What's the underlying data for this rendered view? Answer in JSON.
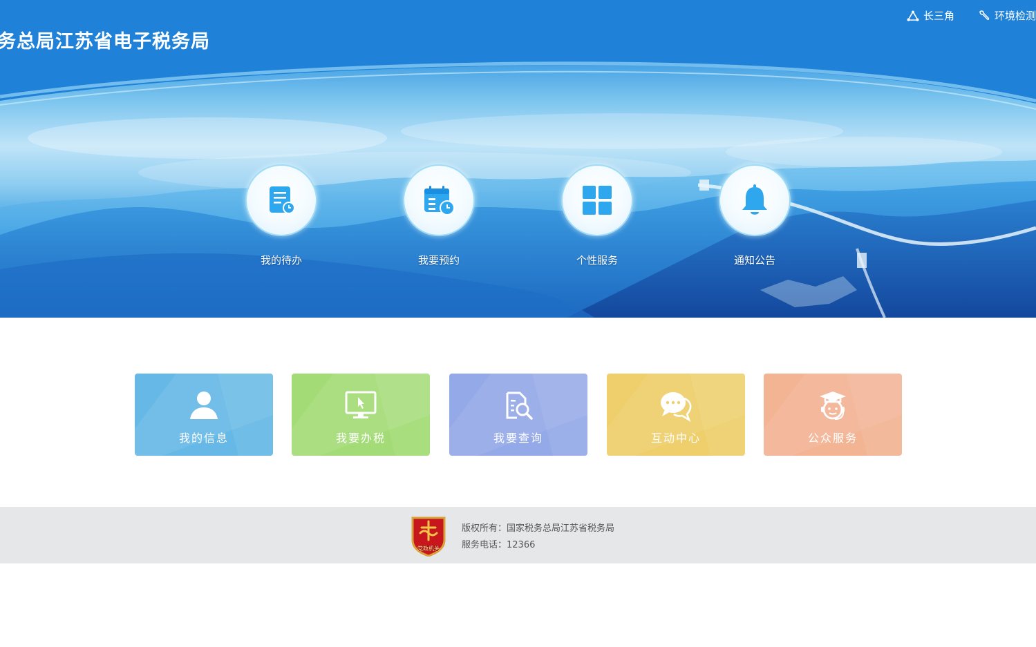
{
  "header": {
    "site_title": "务总局江苏省电子税务局",
    "links": [
      {
        "label": "长三角",
        "icon": "triangle-nodes-icon"
      },
      {
        "label": "环境检测",
        "icon": "wrench-icon"
      }
    ]
  },
  "quick_entries": [
    {
      "label": "我的待办",
      "icon": "todo-list-icon"
    },
    {
      "label": "我要预约",
      "icon": "calendar-clock-icon"
    },
    {
      "label": "个性服务",
      "icon": "grid-icon"
    },
    {
      "label": "通知公告",
      "icon": "bell-icon"
    }
  ],
  "cards": [
    {
      "label": "我的信息",
      "icon": "user-icon",
      "color": "#66b9e6"
    },
    {
      "label": "我要办税",
      "icon": "monitor-cursor-icon",
      "color": "#a3dc76"
    },
    {
      "label": "我要查询",
      "icon": "document-search-icon",
      "color": "#94a9e8"
    },
    {
      "label": "互动中心",
      "icon": "chat-bubbles-icon",
      "color": "#eecf6b"
    },
    {
      "label": "公众服务",
      "icon": "graduate-support-icon",
      "color": "#f3b494"
    }
  ],
  "footer": {
    "badge_text": "党政机关",
    "copyright": "版权所有：国家税务总局江苏省税务局",
    "phone": "服务电话：12366"
  }
}
